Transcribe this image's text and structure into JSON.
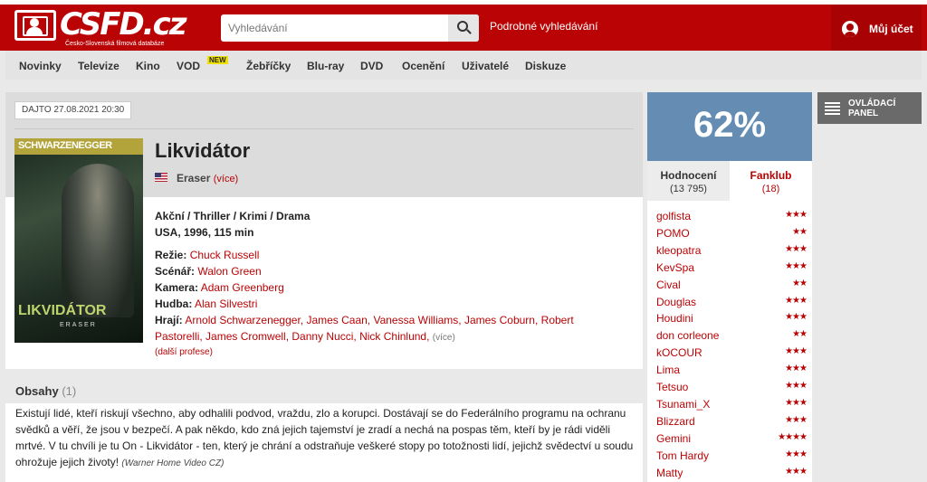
{
  "header": {
    "logo_text": "CSFD.cz",
    "logo_sub": "Česko-Slovenská filmová databáze",
    "search_placeholder": "Vyhledávání",
    "advanced_search": "Podrobné vyhledávání",
    "account_label": "Můj účet",
    "brand_color": "#ba0305"
  },
  "nav": {
    "items": [
      "Novinky",
      "Televize",
      "Kino",
      "VOD",
      "Žebříčky",
      "Blu-ray",
      "DVD",
      "Ocenění",
      "Uživatelé",
      "Diskuze"
    ],
    "vod_badge": "NEW"
  },
  "film": {
    "date_tag": "DAJTO 27.08.2021 20:30",
    "poster_top": "SCHWARZENEGGER",
    "poster_title": "LIKVIDÁTOR",
    "poster_sub": "ERASER",
    "title": "Likvidátor",
    "original_name": "Eraser",
    "more": "(více)",
    "genres": "Akční / Thriller / Krimi / Drama",
    "origin": "USA, 1996, 115 min",
    "creators": [
      {
        "role": "Režie:",
        "names": "Chuck Russell"
      },
      {
        "role": "Scénář:",
        "names": "Walon Green"
      },
      {
        "role": "Kamera:",
        "names": "Adam Greenberg"
      },
      {
        "role": "Hudba:",
        "names": "Alan Silvestri"
      }
    ],
    "cast_role": "Hrají:",
    "cast_line1": "Arnold Schwarzenegger, James Caan, Vanessa Williams, James Coburn, Robert",
    "cast_line2": "Pastorelli, James Cromwell, Danny Nucci, Nick Chinlund,",
    "cast_more": "(více)",
    "extra_professions": "(další profese)"
  },
  "content": {
    "title": "Obsahy",
    "count": "(1)",
    "text": "Existují lidé, kteří riskují všechno, aby odhalili podvod, vraždu, zlo a korupci. Dostávají se do Federálního programu na ochranu svědků a věří, že jsou v bezpečí. A pak někdo, kdo zná jejich tajemství je zradí a nechá na pospas těm, kteří by je rádi viděli mrtvé. V tu chvíli je tu On - Likvidátor - ten, který je chrání a odstraňuje veškeré stopy po totožnosti lidí, jejichž svědectví u soudu ohrožuje jejich životy!",
    "source": "(Warner Home Video CZ)"
  },
  "rating": {
    "value": "62%",
    "box_color": "#658db4",
    "tab_ratings": "Hodnocení",
    "tab_ratings_count": "(13 795)",
    "tab_fanclub": "Fanklub",
    "tab_fanclub_count": "(18)",
    "raters": [
      {
        "name": "golfista",
        "stars": "★★★"
      },
      {
        "name": "POMO",
        "stars": "★★"
      },
      {
        "name": "kleopatra",
        "stars": "★★★"
      },
      {
        "name": "KevSpa",
        "stars": "★★★"
      },
      {
        "name": "Cival",
        "stars": "★★"
      },
      {
        "name": "Douglas",
        "stars": "★★★"
      },
      {
        "name": "Houdini",
        "stars": "★★★"
      },
      {
        "name": "don corleone",
        "stars": "★★"
      },
      {
        "name": "kOCOUR",
        "stars": "★★★"
      },
      {
        "name": "Lima",
        "stars": "★★★"
      },
      {
        "name": "Tetsuo",
        "stars": "★★★"
      },
      {
        "name": "Tsunami_X",
        "stars": "★★★"
      },
      {
        "name": "Blizzard",
        "stars": "★★★"
      },
      {
        "name": "Gemini",
        "stars": "★★★★"
      },
      {
        "name": "Tom Hardy",
        "stars": "★★★"
      },
      {
        "name": "Matty",
        "stars": "★★★"
      }
    ]
  },
  "control_panel": {
    "label": "OVLÁDACÍ PANEL"
  }
}
